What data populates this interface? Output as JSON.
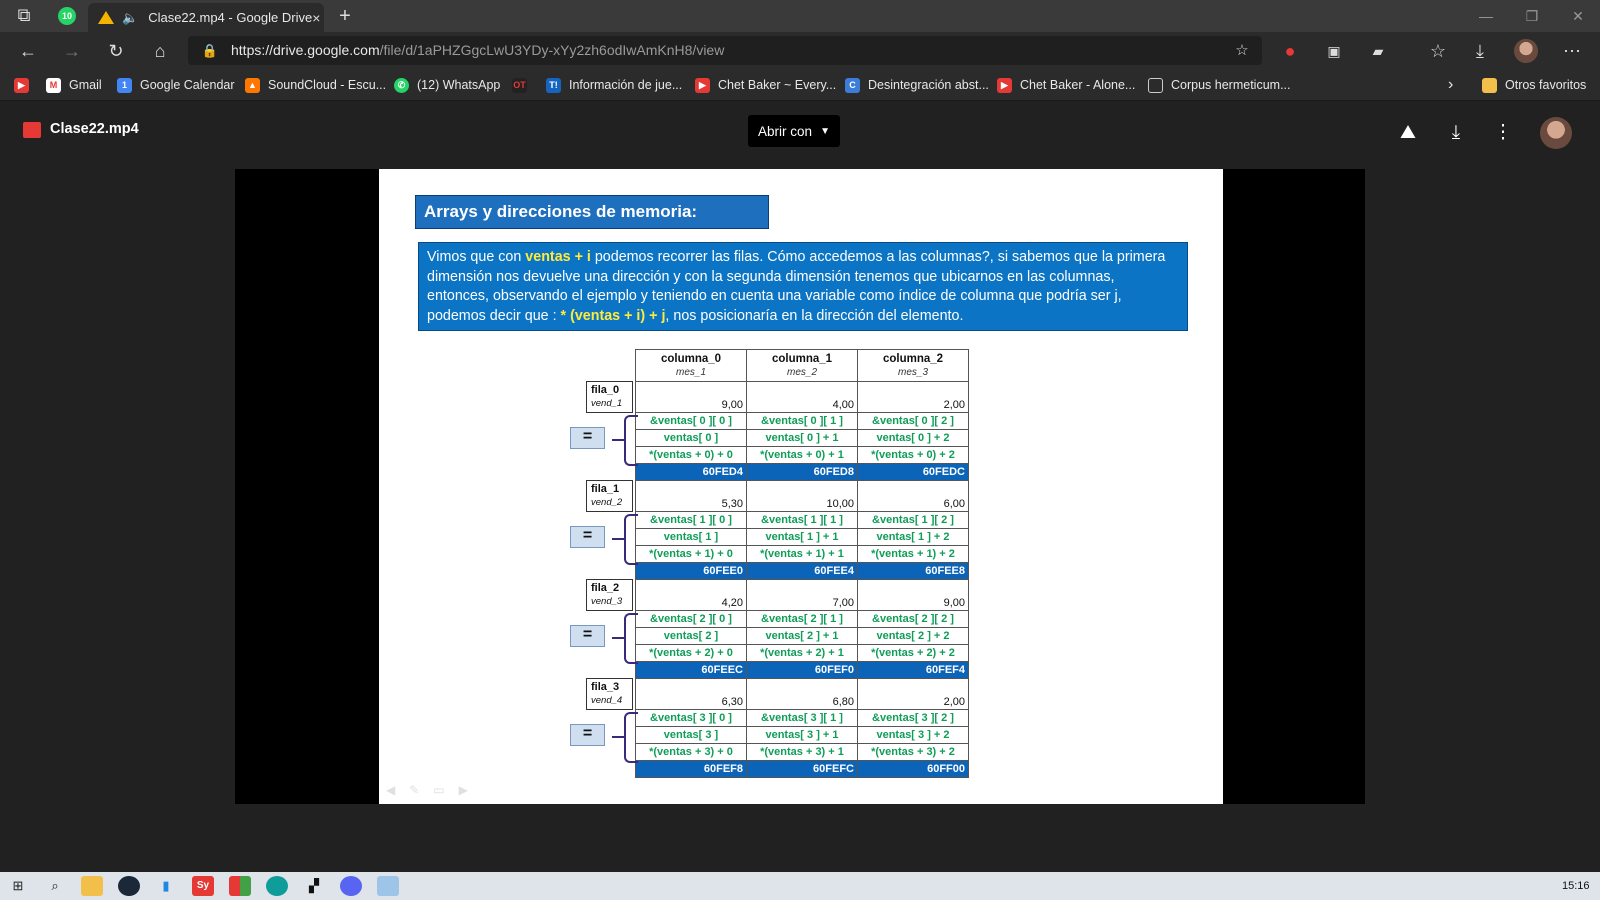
{
  "browser": {
    "tab_title": "Clase22.mp4 - Google Drive",
    "tab_close": "×",
    "new_tab": "+",
    "whatsapp_badge": "10",
    "url_host": "https://drive.google.com",
    "url_path": "/file/d/1aPHZGgcLwU3YDy-xYy2zh6odIwAmKnH8/view",
    "bookmarks": [
      "Gmail",
      "Google Calendar",
      "SoundCloud - Escu...",
      "(12) WhatsApp",
      "Información de jue...",
      "Chet Baker ~ Every...",
      "Desintegración abst...",
      "Chet Baker - Alone...",
      "Corpus hermeticum..."
    ],
    "other_favorites": "Otros favoritos"
  },
  "drive": {
    "file_name": "Clase22.mp4",
    "open_with": "Abrir con"
  },
  "slide": {
    "title": "Arrays y direcciones de memoria:",
    "text_1": "Vimos que  con ",
    "text_hl_1": "ventas + i",
    "text_2": "  podemos recorrer las filas. Cómo accedemos a las columnas?, si sabemos que la primera dimensión nos devuelve una dirección y  con la segunda dimensión  tenemos que ubicarnos en las columnas, entonces, observando el ejemplo y teniendo en cuenta una variable como índice de columna que podría ser j, podemos decir que : ",
    "text_hl_2": "* (ventas + i) + j",
    "text_3": ", nos posicionaría en la dirección del elemento.",
    "columns": [
      {
        "name": "columna_0",
        "sub": "mes_1"
      },
      {
        "name": "columna_1",
        "sub": "mes_2"
      },
      {
        "name": "columna_2",
        "sub": "mes_3"
      }
    ],
    "equals": "=",
    "rows": [
      {
        "label": "fila_0",
        "sub": "vend_1",
        "values": [
          "9,00",
          "4,00",
          "2,00"
        ],
        "refs": [
          "&ventas[ 0 ][ 0 ]",
          "&ventas[ 0 ][ 1 ]",
          "&ventas[ 0 ][ 2 ]"
        ],
        "ptrs": [
          "ventas[ 0 ]",
          "ventas[ 0 ] + 1",
          "ventas[ 0 ] + 2"
        ],
        "derefs": [
          "*(ventas + 0) + 0",
          "*(ventas + 0) + 1",
          "*(ventas + 0) + 2"
        ],
        "addrs": [
          "60FED4",
          "60FED8",
          "60FEDC"
        ]
      },
      {
        "label": "fila_1",
        "sub": "vend_2",
        "values": [
          "5,30",
          "10,00",
          "6,00"
        ],
        "refs": [
          "&ventas[ 1 ][ 0 ]",
          "&ventas[ 1 ][ 1 ]",
          "&ventas[ 1 ][ 2 ]"
        ],
        "ptrs": [
          "ventas[ 1 ]",
          "ventas[ 1 ] + 1",
          "ventas[ 1 ] + 2"
        ],
        "derefs": [
          "*(ventas + 1) + 0",
          "*(ventas + 1) + 1",
          "*(ventas + 1) + 2"
        ],
        "addrs": [
          "60FEE0",
          "60FEE4",
          "60FEE8"
        ]
      },
      {
        "label": "fila_2",
        "sub": "vend_3",
        "values": [
          "4,20",
          "7,00",
          "9,00"
        ],
        "refs": [
          "&ventas[ 2 ][ 0 ]",
          "&ventas[ 2 ][ 1 ]",
          "&ventas[ 2 ][ 2 ]"
        ],
        "ptrs": [
          "ventas[ 2 ]",
          "ventas[ 2 ] + 1",
          "ventas[ 2 ] + 2"
        ],
        "derefs": [
          "*(ventas + 2) + 0",
          "*(ventas + 2) + 1",
          "*(ventas + 2) + 2"
        ],
        "addrs": [
          "60FEEC",
          "60FEF0",
          "60FEF4"
        ]
      },
      {
        "label": "fila_3",
        "sub": "vend_4",
        "values": [
          "6,30",
          "6,80",
          "2,00"
        ],
        "refs": [
          "&ventas[ 3 ][ 0 ]",
          "&ventas[ 3 ][ 1 ]",
          "&ventas[ 3 ][ 2 ]"
        ],
        "ptrs": [
          "ventas[ 3 ]",
          "ventas[ 3 ] + 1",
          "ventas[ 3 ] + 2"
        ],
        "derefs": [
          "*(ventas + 3) + 0",
          "*(ventas + 3) + 1",
          "*(ventas + 3) + 2"
        ],
        "addrs": [
          "60FEF8",
          "60FEFC",
          "60FF00"
        ]
      }
    ]
  },
  "taskbar": {
    "clock": "15:16"
  }
}
